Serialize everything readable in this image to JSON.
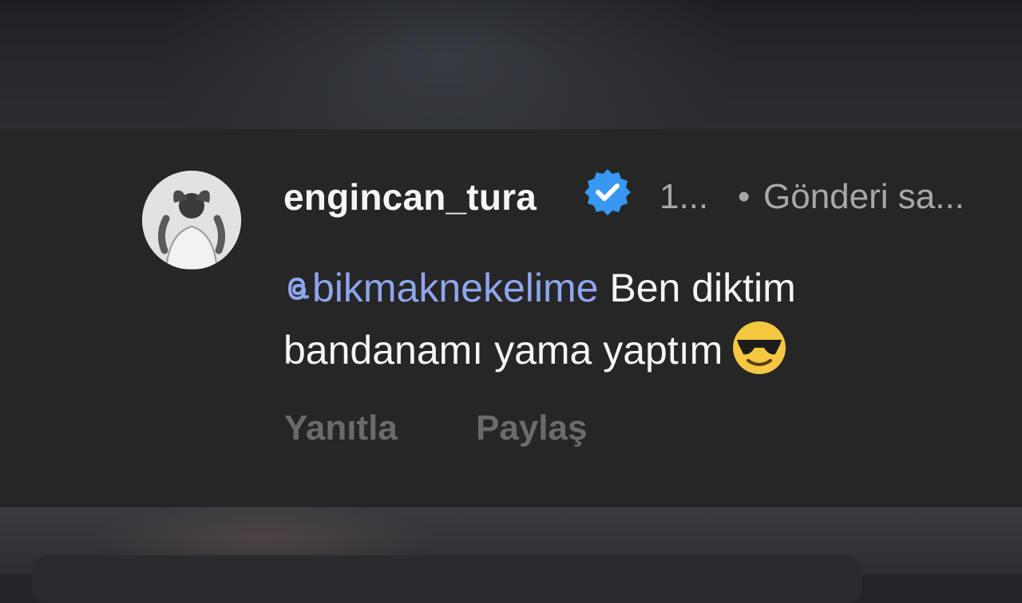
{
  "comment": {
    "username": "engincan_tura",
    "time": "1...",
    "dot": "•",
    "status": "Gönderi sa...",
    "mention": "bikmaknekelime",
    "text": " Ben diktim bandanamı yama yaptım",
    "emoji": "smiling-face-with-sunglasses-icon",
    "verified": true
  },
  "actions": {
    "reply_label": "Yanıtla",
    "share_label": "Paylaş"
  },
  "colors": {
    "background": "#262626",
    "mention": "#8fa6ee",
    "verified": "#3897f0",
    "muted": "#6b6b6b"
  }
}
